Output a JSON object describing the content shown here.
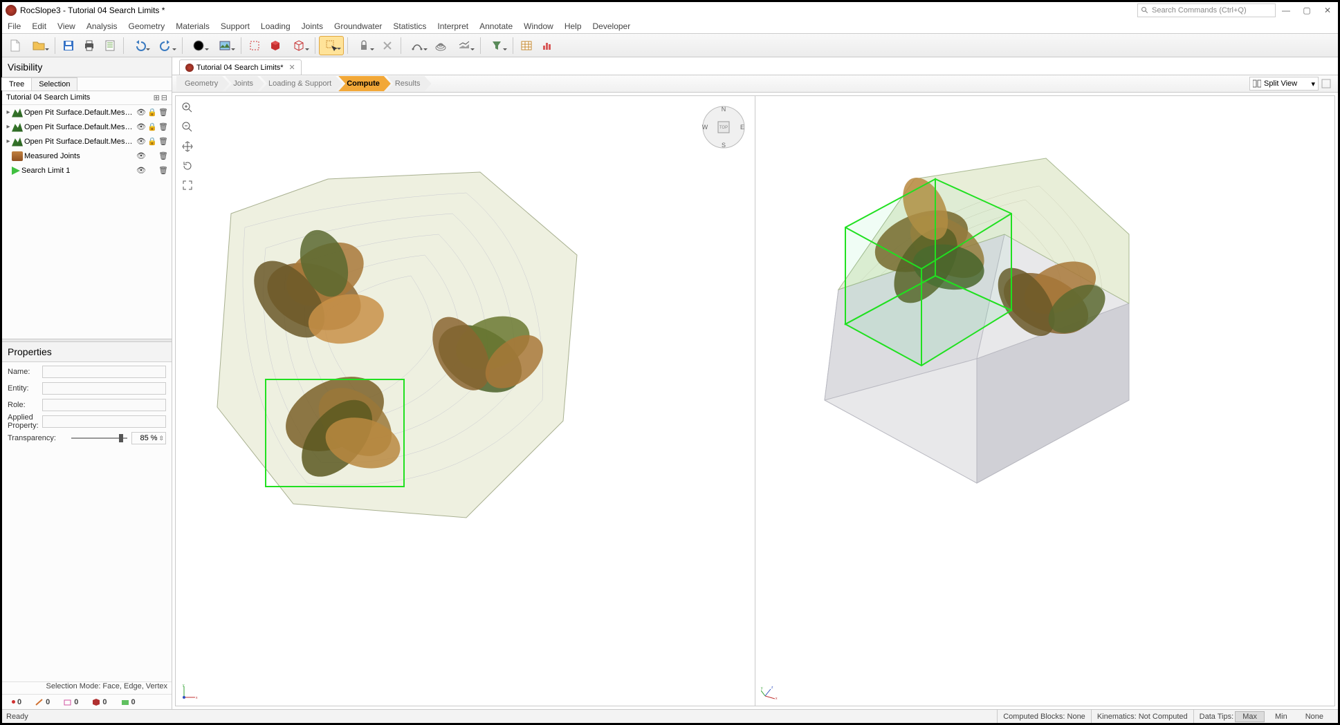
{
  "app": {
    "title": "RocSlope3 - Tutorial 04 Search Limits *",
    "search_placeholder": "Search Commands (Ctrl+Q)"
  },
  "menu": [
    "File",
    "Edit",
    "View",
    "Analysis",
    "Geometry",
    "Materials",
    "Support",
    "Loading",
    "Joints",
    "Groundwater",
    "Statistics",
    "Interpret",
    "Annotate",
    "Window",
    "Help",
    "Developer"
  ],
  "panels": {
    "visibility_title": "Visibility",
    "tree_tab": "Tree",
    "selection_tab": "Selection",
    "tree_header": "Tutorial 04 Search Limits",
    "items": [
      {
        "label": "Open Pit Surface.Default.Mesh_ext…",
        "type": "surf",
        "exp": true,
        "lock": true
      },
      {
        "label": "Open Pit Surface.Default.Mesh_ext…",
        "type": "surf",
        "exp": true,
        "lock": true
      },
      {
        "label": "Open Pit Surface.Default.Mesh_ext…",
        "type": "surf",
        "exp": true,
        "lock": true
      },
      {
        "label": "Measured Joints",
        "type": "joint",
        "exp": false,
        "lock": false
      },
      {
        "label": "Search Limit 1",
        "type": "sl",
        "exp": false,
        "lock": false
      }
    ],
    "properties_title": "Properties",
    "prop_name": "Name:",
    "prop_entity": "Entity:",
    "prop_role": "Role:",
    "prop_applied": "Applied Property:",
    "prop_transparency": "Transparency:",
    "transparency_value": "85 %",
    "selection_mode": "Selection Mode: Face, Edge, Vertex",
    "counts": [
      "0",
      "0",
      "0",
      "0",
      "0"
    ]
  },
  "doc": {
    "tab": "Tutorial 04 Search Limits*"
  },
  "workflow": [
    "Geometry",
    "Joints",
    "Loading & Support",
    "Compute",
    "Results"
  ],
  "workflow_active": 3,
  "view_mode": "Split View",
  "compass": {
    "n": "N",
    "s": "S",
    "e": "E",
    "w": "W",
    "top": "TOP"
  },
  "status": {
    "ready": "Ready",
    "blocks": "Computed Blocks:  None",
    "kinematics": "Kinematics:  Not Computed",
    "datatips": "Data Tips:",
    "max": "Max",
    "min": "Min",
    "none": "None"
  }
}
